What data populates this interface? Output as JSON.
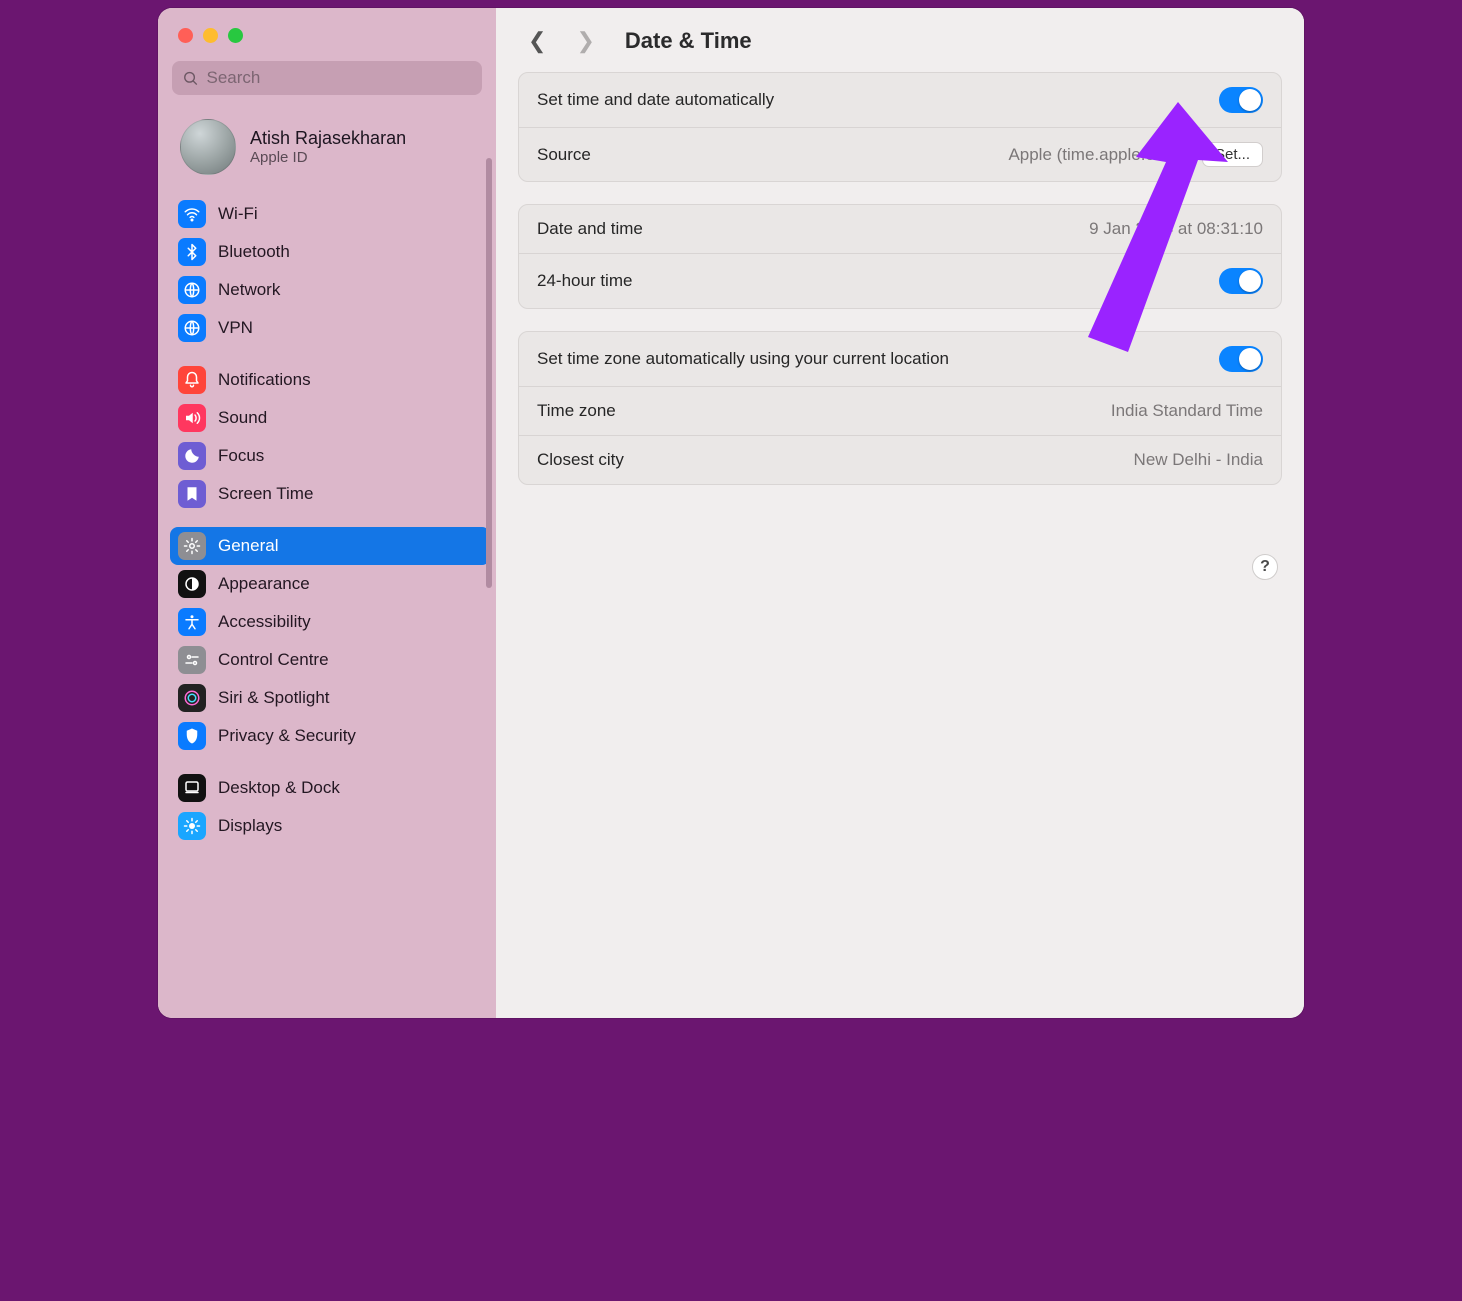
{
  "window": {
    "title": "Date & Time"
  },
  "search": {
    "placeholder": "Search"
  },
  "account": {
    "name": "Atish Rajasekharan",
    "sub": "Apple ID"
  },
  "sidebar": {
    "items": [
      {
        "id": "wifi",
        "label": "Wi-Fi",
        "bg": "#0a7bff"
      },
      {
        "id": "bluetooth",
        "label": "Bluetooth",
        "bg": "#0a7bff"
      },
      {
        "id": "network",
        "label": "Network",
        "bg": "#0a7bff"
      },
      {
        "id": "vpn",
        "label": "VPN",
        "bg": "#0a7bff"
      },
      {
        "id": "spacer1",
        "spacer": true
      },
      {
        "id": "notifications",
        "label": "Notifications",
        "bg": "#ff453a"
      },
      {
        "id": "sound",
        "label": "Sound",
        "bg": "#ff375f"
      },
      {
        "id": "focus",
        "label": "Focus",
        "bg": "#6e5dd3"
      },
      {
        "id": "screentime",
        "label": "Screen Time",
        "bg": "#6e5dd3"
      },
      {
        "id": "spacer2",
        "spacer": true
      },
      {
        "id": "general",
        "label": "General",
        "bg": "#8e8e93",
        "selected": true
      },
      {
        "id": "appearance",
        "label": "Appearance",
        "bg": "#111"
      },
      {
        "id": "accessibility",
        "label": "Accessibility",
        "bg": "#0a7bff"
      },
      {
        "id": "controlcentre",
        "label": "Control Centre",
        "bg": "#8e8e93"
      },
      {
        "id": "siri",
        "label": "Siri & Spotlight",
        "bg": "#222"
      },
      {
        "id": "privacy",
        "label": "Privacy & Security",
        "bg": "#0a7bff"
      },
      {
        "id": "spacer3",
        "spacer": true
      },
      {
        "id": "desktopdock",
        "label": "Desktop & Dock",
        "bg": "#111"
      },
      {
        "id": "displays",
        "label": "Displays",
        "bg": "#1aa6ff"
      }
    ]
  },
  "main": {
    "auto_set_label": "Set time and date automatically",
    "auto_set_on": true,
    "source_label": "Source",
    "source_value": "Apple (time.apple.com.)",
    "source_btn": "Set...",
    "datetime_label": "Date and time",
    "datetime_value": "9 Jan 2024 at 08:31:10",
    "h24_label": "24-hour time",
    "h24_on": true,
    "tz_auto_label": "Set time zone automatically using your current location",
    "tz_auto_on": true,
    "tz_label": "Time zone",
    "tz_value": "India Standard Time",
    "closest_label": "Closest city",
    "closest_value": "New Delhi - India"
  },
  "help_label": "?",
  "colors": {
    "accent": "#0a84ff",
    "annotation": "#9a23ff"
  }
}
